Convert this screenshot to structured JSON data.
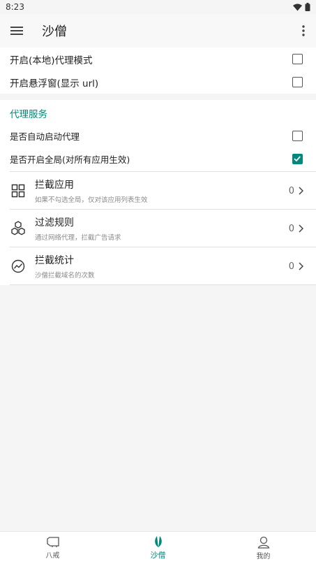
{
  "status_bar": {
    "time": "8:23"
  },
  "app_bar": {
    "title": "沙僧"
  },
  "settings": [
    {
      "label": "开启(本地)代理模式",
      "checked": false
    },
    {
      "label": "开启悬浮窗(显示 url)",
      "checked": false
    }
  ],
  "proxy_section": {
    "header": "代理服务",
    "toggles": [
      {
        "label": "是否自动启动代理",
        "checked": false
      },
      {
        "label": "是否开启全局(对所有应用生效)",
        "checked": true
      }
    ],
    "items": [
      {
        "title": "拦截应用",
        "subtitle": "如果不勾选全局，仅对该应用列表生效",
        "count": "0",
        "icon": "grid-icon"
      },
      {
        "title": "过滤规则",
        "subtitle": "通过网络代理，拦截广告请求",
        "count": "0",
        "icon": "hexagons-icon"
      },
      {
        "title": "拦截统计",
        "subtitle": "沙僧拦截域名的次数",
        "count": "0",
        "icon": "chart-icon"
      }
    ]
  },
  "bottom_nav": [
    {
      "label": "八戒",
      "icon": "pig-icon",
      "active": false
    },
    {
      "label": "沙僧",
      "icon": "leaf-icon",
      "active": true
    },
    {
      "label": "我的",
      "icon": "person-icon",
      "active": false
    }
  ],
  "colors": {
    "accent": "#00897b",
    "background": "#f5f5f5",
    "surface": "#ffffff"
  }
}
